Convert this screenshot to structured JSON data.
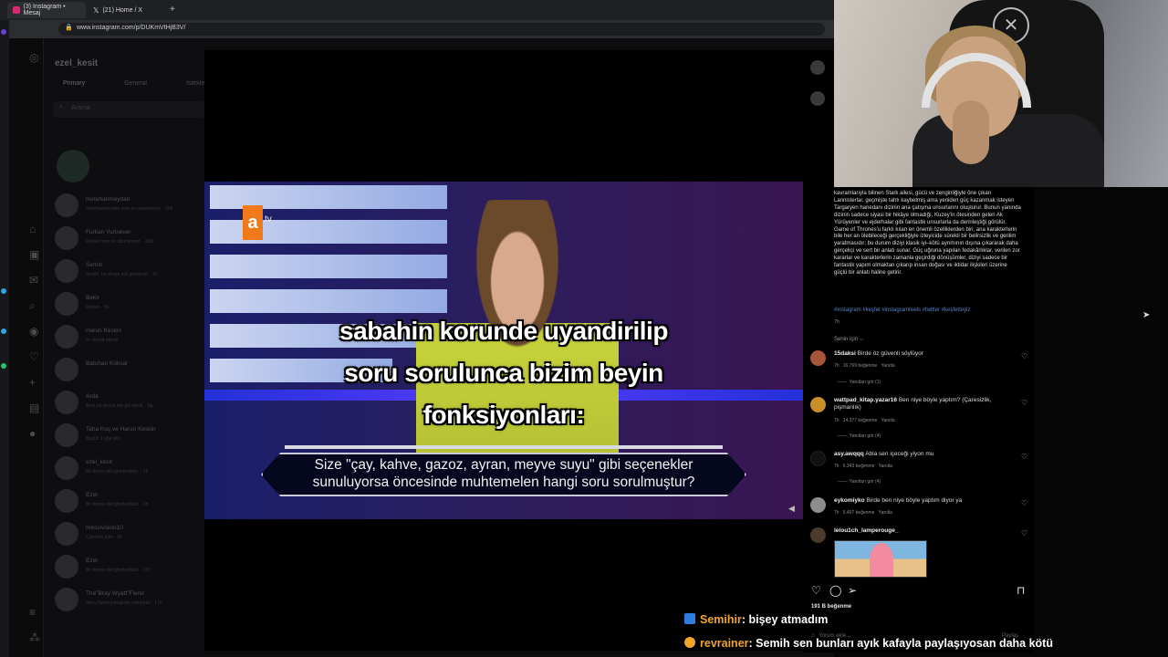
{
  "browser": {
    "tabs": [
      {
        "label": "(3) Instagram • Mesaj",
        "active": true,
        "favicon_color": "#d62976"
      },
      {
        "label": "(21) Home / X",
        "active": false,
        "favicon_color": "#000000"
      }
    ],
    "new_tab_label": "+",
    "url": "www.instagram.com/p/DUKmVtHjB3V/"
  },
  "instagram_dm": {
    "username": "ezel_kesit",
    "tabs": [
      "Primary",
      "General",
      "İstekle"
    ],
    "search_placeholder": "Arama",
    "conversations": [
      {
        "name": "metehanmeydan",
        "sub": "metehanmeydan sent an attachment. · 26d"
      },
      {
        "name": "Furkan Yurtsever",
        "sub": "Furkan sent an attachment. · 33d"
      },
      {
        "name": "Semih",
        "sub": "Semih: bir dosya ekli gönderdi. · 1h"
      },
      {
        "name": "Bekir",
        "sub": "Furkan · 5h"
      },
      {
        "name": "Harun Keskin",
        "sub": "3+ dosya ekledi"
      },
      {
        "name": "Batuhan Köksal",
        "sub": ""
      },
      {
        "name": "Arda",
        "sub": "Arda bir dosya ekli gönderdi. · 6g"
      },
      {
        "name": "Taha Koç ve Harun Keskin",
        "sub": "Bugün 1 öğe ekli"
      },
      {
        "name": "ezel_kesit",
        "sub": "Bir dosya ekli gönderdiniz. · 1h"
      },
      {
        "name": "Ezel",
        "sub": "Bir dosya ekli gönderdiniz. · 1h"
      },
      {
        "name": "messivision10",
        "sub": "Cami'nin bize · 3h"
      },
      {
        "name": "Ezel",
        "sub": "Bir dosya ekli gönderdiniz. · 17h"
      },
      {
        "name": "The\"Bray Wyatt\"Fiend",
        "sub": "https://www.instagram.com/reel/ · 17h"
      }
    ]
  },
  "video": {
    "channel_logo": "a",
    "channel_logo_suffix": "tv",
    "overlay_lines": [
      "sabahin korunde uyandirilip",
      "soru sorulunca bizim beyin",
      "fonksiyonları:"
    ],
    "question_lines": [
      "Size \"çay, kahve, gazoz, ayran, meyve suyu\" gibi seçenekler",
      "sunuluyorsa öncesinde muhtemelen hangi soru sorulmuştur?"
    ]
  },
  "post": {
    "caption": "kavramlarıyla bilinen Stark ailesi, gücü ve zenginliğiyle öne çıkan Lannisterlar, geçmişte tahtı kaybetmiş ama yeniden güç kazanmak isteyen Targaryen hanedanı dizinin ana çatışma unsurlarını oluşturur. Bunun yanında dizinin sadece siyasi bir hikâye olmadığı, Kuzey'in ötesinden gelen Ak Yürüyenler ve ejderhalar gibi fantastik unsurlarla da derinleştiği görülür. Game of Thrones'u farklı kılan en önemli özelliklerden biri, ana karakterlerin bile her an ölebileceği gerçekliğiyle izleyicide sürekli bir belirsizlik ve gerilim yaratmasıdır; bu durum diziyi klasik iyi–kötü ayrımının dışına çıkararak daha gerçekçi ve sert bir anlatı sunar. Güç uğruna yapılan fedakârlıklar, verilen zor kararlar ve karakterlerin zamanla geçirdiği dönüşümler, diziyi sadece bir fantastik yapım olmaktan çıkarıp insan doğası ve iktidar ilişkileri üzerine güçlü bir anlatı haline getirir.",
    "hashtags": "#instagram #keşfet #instagramreels #twitter #keşfetteyiz",
    "time": "7h",
    "for_you_label": "Senin için ⌵",
    "comments": [
      {
        "user": "15daksi",
        "text": "Birde öz güvenli söylüyor",
        "time": "7h",
        "likes": "16.769 beğenme",
        "reply": "Yanıtla",
        "replies": "Yanıtları gör (1)",
        "avatar_color": "#a4553a"
      },
      {
        "user": "wattpad_kitap.yazar16",
        "text": "Ben niye böyle yaptım? (Çaresizlik, pişmanlık)",
        "time": "7h",
        "likes": "14.377 beğenme",
        "reply": "Yanıtla",
        "replies": "Yanıtları gör (4)",
        "avatar_color": "#c98f2a"
      },
      {
        "user": "asy.awqqq",
        "text": "Abla sen içeceği yiyon mu",
        "time": "7h",
        "likes": "6.343 beğenme",
        "reply": "Yanıtla",
        "replies": "Yanıtları gör (4)",
        "avatar_color": "#111111"
      },
      {
        "user": "eykomiyko",
        "text": "Birde ben niye böyle yaptım diyor ya",
        "time": "7h",
        "likes": "5.497 beğenme",
        "reply": "Yanıtla",
        "replies": "",
        "avatar_color": "#8d8d8d"
      },
      {
        "user": "lelou1ch_lamperouge_",
        "text": "",
        "time": "",
        "likes": "",
        "reply": "",
        "replies": "",
        "avatar_color": "#4a3b2a"
      }
    ],
    "likes_total": "191 B beğenme",
    "comment_placeholder": "Yorum ekle...",
    "post_button": "Paylaş"
  },
  "chat": [
    {
      "name": "Semihir",
      "message": ": bişey atmadım",
      "badge_color": "#2f7de1"
    },
    {
      "name": "revrainer",
      "message": ": Semih sen bunları ayık kafayla paylaşıyosan daha kötü",
      "badge_color": "#f0a52b"
    }
  ]
}
